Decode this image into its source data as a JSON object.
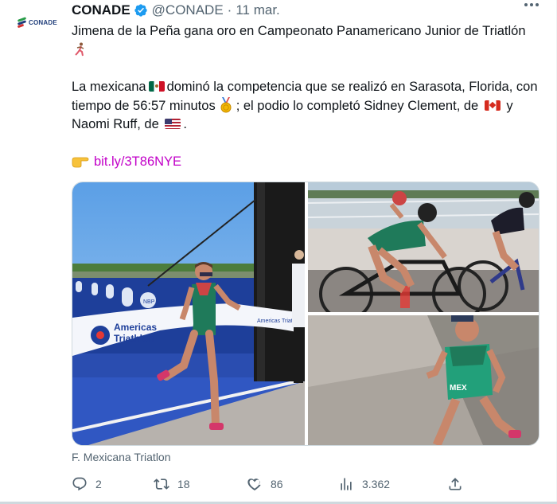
{
  "account": {
    "avatar_logo_text": "CONADE",
    "name": "CONADE",
    "handle": "@CONADE",
    "separator": "·",
    "date": "11 mar."
  },
  "tweet": {
    "line1": "Jimena de la Peña gana oro en Campeonato Panamericano Junior de Triatlón",
    "line2_part1": "La mexicana",
    "line2_part2": "dominó la competencia que se realizó en Sarasota, Florida, con tiempo de 56:57 minutos",
    "line2_part3": "; el podio lo completó Sidney Clement, de",
    "line2_part4": "y Naomi Ruff, de",
    "line2_part5": ".",
    "link": "bit.ly/3T86NYE"
  },
  "media": {
    "banner_line1": "Americas",
    "banner_line2": "Triathlon",
    "banner_right": "Americas Triathlon",
    "pole_text": "NBP",
    "bib_text": "MEX"
  },
  "source": "F. Mexicana Triatlon",
  "actions": {
    "replies": "2",
    "retweets": "18",
    "likes": "86",
    "views": "3.362"
  },
  "icons": {
    "verified": "verified-badge-icon",
    "more": "more-dots-icon",
    "reply": "reply-icon",
    "retweet": "retweet-icon",
    "like": "heart-icon",
    "views": "views-chart-icon",
    "share": "share-icon"
  },
  "colors": {
    "link": "#c200c8",
    "verified": "#1d9bf0",
    "secondary_text": "#536471"
  }
}
